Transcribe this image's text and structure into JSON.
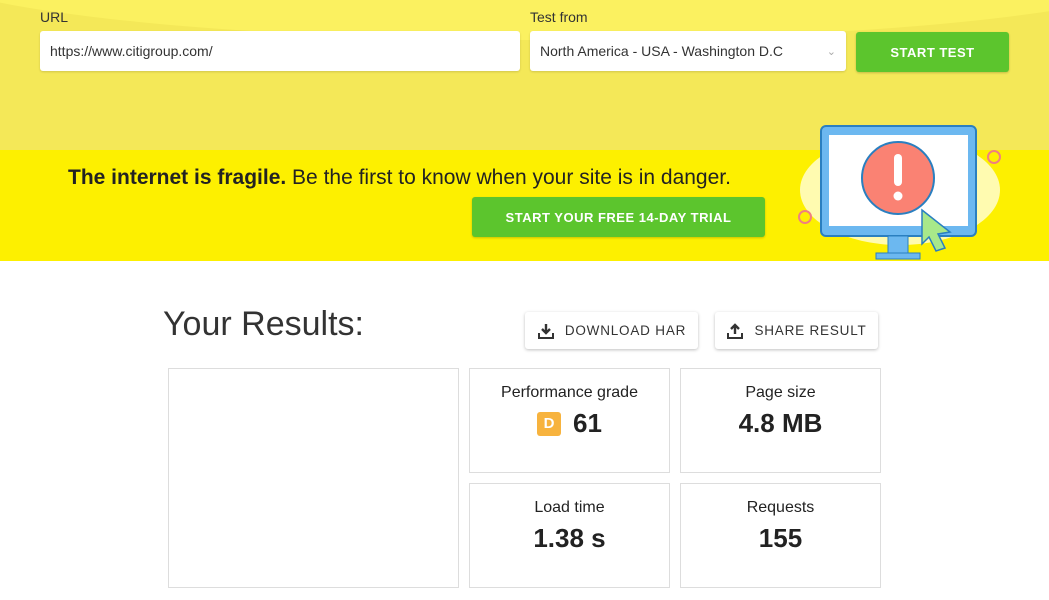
{
  "form": {
    "url_label": "URL",
    "url_value": "https://www.citigroup.com/",
    "from_label": "Test from",
    "from_value": "North America - USA - Washington D.C",
    "start_label": "START TEST"
  },
  "banner": {
    "bold": "The internet is fragile.",
    "text": " Be the first to know when your site is in danger.",
    "cta": "START YOUR FREE 14-DAY TRIAL"
  },
  "results": {
    "title": "Your Results:",
    "download": "DOWNLOAD HAR",
    "share": "SHARE RESULT",
    "cards": [
      {
        "label": "Performance grade",
        "grade": "D",
        "value": "61"
      },
      {
        "label": "Page size",
        "value": "4.8 MB"
      },
      {
        "label": "Load time",
        "value": "1.38 s"
      },
      {
        "label": "Requests",
        "value": "155"
      }
    ]
  },
  "colors": {
    "green": "#5cc52d",
    "yellow": "#fdf000",
    "grade_d": "#f7b33e"
  }
}
